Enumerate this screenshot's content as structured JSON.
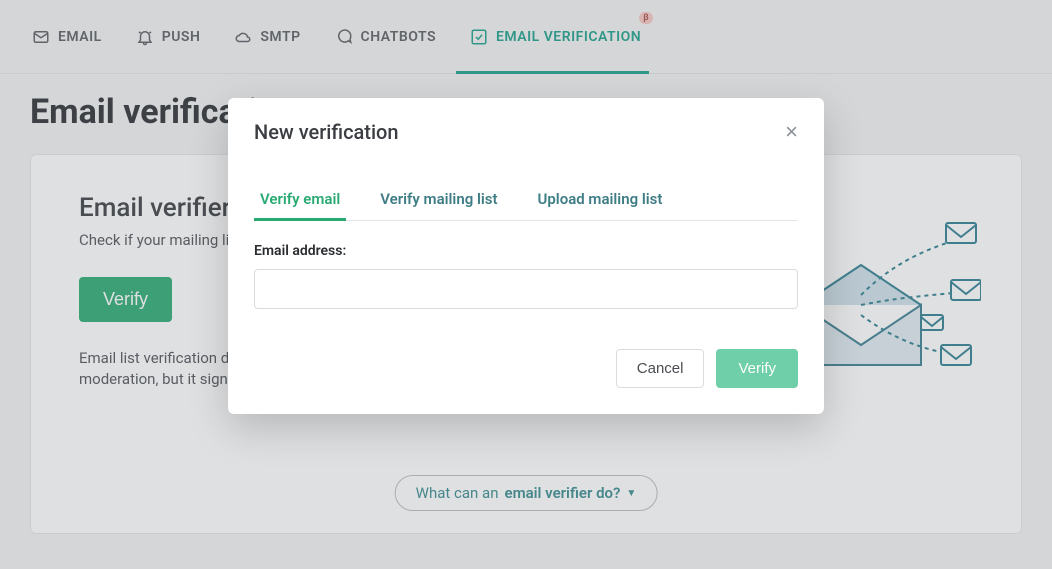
{
  "nav": {
    "items": [
      {
        "label": "EMAIL",
        "icon": "mail-icon"
      },
      {
        "label": "PUSH",
        "icon": "bell-icon"
      },
      {
        "label": "SMTP",
        "icon": "cloud-icon"
      },
      {
        "label": "CHATBOTS",
        "icon": "chat-icon"
      },
      {
        "label": "EMAIL VERIFICATION",
        "icon": "check-icon",
        "active": true,
        "badge": "β"
      }
    ]
  },
  "page": {
    "title": "Email verification",
    "card": {
      "title": "Email verifier",
      "subtitle": "Check if your mailing lists contain inactive email addresses",
      "verify_button": "Verify",
      "note": "Email list verification does not guarantee that your email will not be blocked by moderation, but it significantly increases the chance."
    },
    "faq": {
      "prefix": "What can an ",
      "bold": "email verifier do?"
    }
  },
  "modal": {
    "title": "New verification",
    "tabs": [
      {
        "label": "Verify email",
        "active": true
      },
      {
        "label": "Verify mailing list"
      },
      {
        "label": "Upload mailing list"
      }
    ],
    "field_label": "Email address:",
    "email_value": "",
    "cancel": "Cancel",
    "verify": "Verify"
  },
  "colors": {
    "accent": "#19a08a",
    "primary_button": "#2aaa73",
    "modal_verify": "#6fcfa8"
  }
}
